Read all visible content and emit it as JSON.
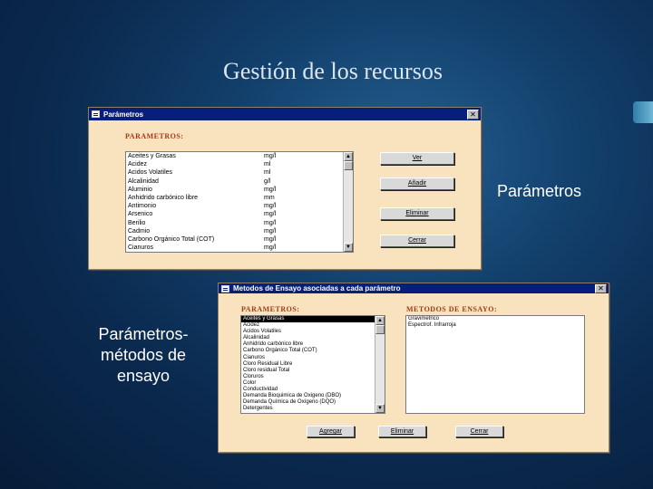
{
  "slide": {
    "title": "Gestión de los recursos",
    "label_parametros": "Parámetros",
    "label_metodos": "Parámetros-métodos de ensayo"
  },
  "params_window": {
    "title": "Parámetros",
    "header": "PARAMETROS:",
    "close_glyph": "✕",
    "rows": [
      {
        "name": "Aceites y Grasas",
        "unit": "mg/l"
      },
      {
        "name": "Acidez",
        "unit": "ml"
      },
      {
        "name": "Acidos Volatiles",
        "unit": "ml"
      },
      {
        "name": "Alcalinidad",
        "unit": "g/l"
      },
      {
        "name": "Aluminio",
        "unit": "mg/l"
      },
      {
        "name": "Anhidrido carbónico libre",
        "unit": "mm"
      },
      {
        "name": "Antimonio",
        "unit": "mg/l"
      },
      {
        "name": "Arsenico",
        "unit": "mg/l"
      },
      {
        "name": "Berilio",
        "unit": "mg/l"
      },
      {
        "name": "Cadmio",
        "unit": "mg/l"
      },
      {
        "name": "Carbono Orgánico Total (COT)",
        "unit": "mg/l"
      },
      {
        "name": "Cianuros",
        "unit": "mg/l"
      }
    ],
    "buttons": {
      "ver": "Ver",
      "anadir": "Añadir",
      "eliminar": "Eliminar",
      "cerrar": "Cerrar"
    }
  },
  "methods_window": {
    "title": "Metodos de Ensayo asociadas a cada parámetro",
    "params_header": "PARAMETROS:",
    "methods_header": "METODOS DE ENSAYO:",
    "close_glyph": "✕",
    "params": [
      "Aceites y Grasas",
      "Acidez",
      "Acidos Volatiles",
      "Alcalinidad",
      "Anhidrido carbónico libre",
      "Carbono Orgánico Total (COT)",
      "Cianuros",
      "Cloro Residual Libre",
      "Cloro residual Total",
      "Cloruros",
      "Color",
      "Conductividad",
      "Demanda Bioquimica de Oxigeno (DBO)",
      "Demanda Química de Oxígeno (DQO)",
      "Detergentes"
    ],
    "selected_index": 0,
    "methods": [
      "Gravimetrico",
      "Espectrof. Infrarroja"
    ],
    "buttons": {
      "agregar": "Agregar",
      "eliminar": "Eliminar",
      "cerrar": "Cerrar"
    }
  }
}
